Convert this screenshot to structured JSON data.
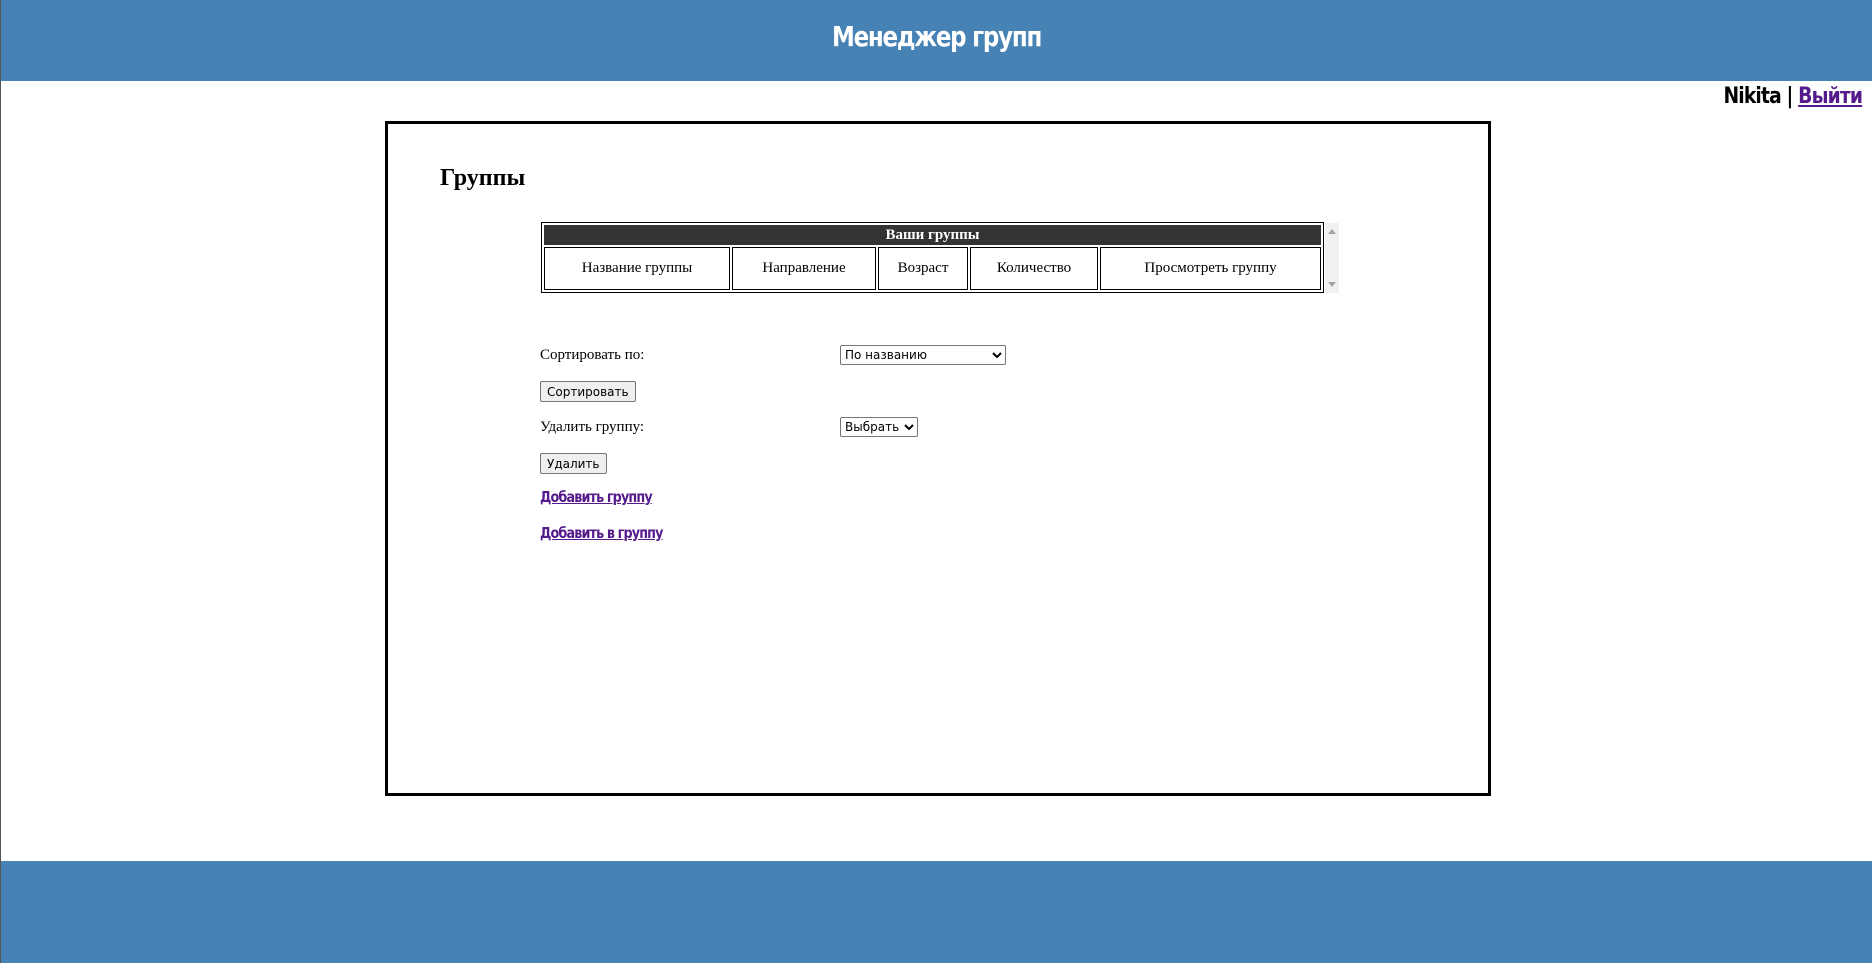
{
  "header": {
    "title": "Менеджер групп"
  },
  "user": {
    "name": "Nikita",
    "separator": "|",
    "logout_label": "Выйти"
  },
  "main": {
    "title": "Группы",
    "table": {
      "caption": "Ваши группы",
      "columns": [
        "Название группы",
        "Направление",
        "Возраст",
        "Количество",
        "Просмотреть группу"
      ]
    },
    "sort": {
      "label": "Сортировать по:",
      "selected": "По названию",
      "button_label": "Сортировать"
    },
    "delete": {
      "label": "Удалить группу:",
      "selected": "Выбрать",
      "button_label": "Удалить"
    },
    "links": {
      "add_group": "Добавить группу",
      "add_to_group": "Добавить в группу"
    }
  },
  "colors": {
    "header_bg": "#4682b4",
    "table_caption_bg": "#333333",
    "link_visited": "#551a8b"
  }
}
